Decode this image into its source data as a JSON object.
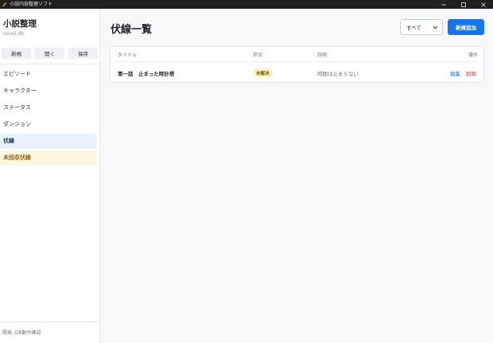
{
  "window": {
    "title": "小説内容整理ソフト",
    "controls": [
      "minimize-icon",
      "maximize-icon",
      "close-icon"
    ]
  },
  "sidebar": {
    "title": "小説整理",
    "db_file": "novel.db",
    "buttons": {
      "new": "新規",
      "open": "開く",
      "save": "保存"
    },
    "items": [
      {
        "label": "エピソード",
        "state": "normal"
      },
      {
        "label": "キャラクター",
        "state": "normal"
      },
      {
        "label": "ステータス",
        "state": "normal"
      },
      {
        "label": "ダンジョン",
        "state": "normal"
      },
      {
        "label": "伏線",
        "state": "active"
      },
      {
        "label": "未回収伏線",
        "state": "highlight"
      }
    ],
    "footer": "開発: DB動作確認"
  },
  "main": {
    "title": "伏線一覧",
    "filter": {
      "selected": "すべて"
    },
    "add_button": "新規追加",
    "table": {
      "headers": {
        "title": "タイトル",
        "status": "状況",
        "desc": "説明",
        "actions": "操作"
      },
      "rows": [
        {
          "title": "第一話　止まった時計塔",
          "status": "未解決",
          "desc": "時間は止まらない",
          "edit": "編集",
          "delete": "削除"
        }
      ]
    }
  },
  "colors": {
    "accent": "#1a73e8",
    "danger": "#d93025",
    "active_nav_bg": "#e8f2fd",
    "warn_nav_bg": "#fff8e1",
    "badge_bg": "#fff1c2"
  }
}
